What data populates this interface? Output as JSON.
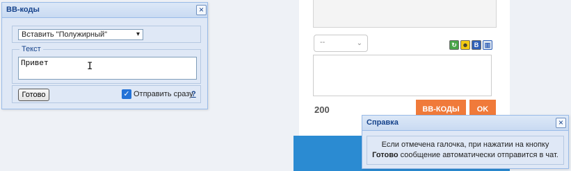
{
  "page": {
    "select_value": "--",
    "counter": "200",
    "bbcodes_button": "BB-КОДЫ",
    "ok_button": "OK",
    "toolbar_icons": [
      "refresh-icon",
      "smile-icon",
      "bold-icon",
      "image-icon"
    ],
    "bold_icon_label": "B"
  },
  "bb_window": {
    "title": "BB-коды",
    "close_symbol": "×",
    "insert_select_value": "Вставить \"Полужирный\"",
    "text_legend": "Текст",
    "text_value": "Привет",
    "done_button": "Готово",
    "send_checked": true,
    "send_label": "Отправить сразу",
    "help_link": "?"
  },
  "help_window": {
    "title": "Справка",
    "close_symbol": "×",
    "line1": "Если отмечена галочка, при нажатии на кнопку",
    "line2_bold": "Готово",
    "line2_rest": " сообщение автоматически отправится в чат."
  },
  "colors": {
    "accent_orange": "#f07a3a",
    "accent_blue": "#2b8bd2",
    "window_title": "#15428b"
  }
}
